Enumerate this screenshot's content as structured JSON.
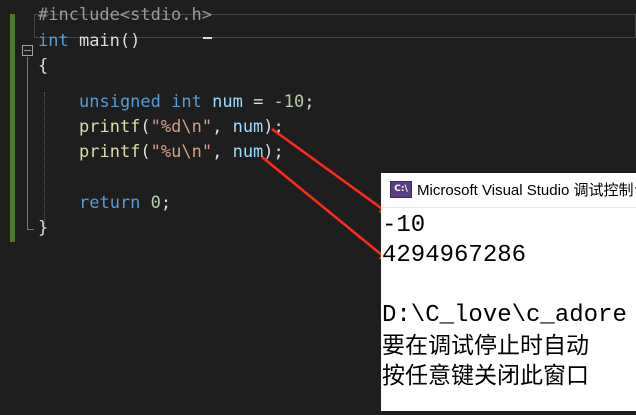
{
  "editor": {
    "lines": [
      {
        "id": "include",
        "tokens": [
          {
            "t": "#include<stdio.h>",
            "c": "pp"
          }
        ]
      },
      {
        "id": "main",
        "tokens": [
          {
            "t": "int",
            "c": "kw"
          },
          {
            "t": " main()",
            "c": "plain"
          }
        ]
      },
      {
        "id": "open-brace",
        "tokens": [
          {
            "t": "{",
            "c": "plain"
          }
        ]
      },
      {
        "id": "blank1",
        "tokens": []
      },
      {
        "id": "decl",
        "tokens": [
          {
            "t": "unsigned",
            "c": "kw"
          },
          {
            "t": " ",
            "c": "plain"
          },
          {
            "t": "int",
            "c": "kw"
          },
          {
            "t": " ",
            "c": "plain"
          },
          {
            "t": "num",
            "c": "var"
          },
          {
            "t": " = ",
            "c": "plain"
          },
          {
            "t": "-10",
            "c": "num"
          },
          {
            "t": ";",
            "c": "plain"
          }
        ]
      },
      {
        "id": "printf-d",
        "tokens": [
          {
            "t": "printf",
            "c": "fn"
          },
          {
            "t": "(",
            "c": "plain"
          },
          {
            "t": "\"%d\\n\"",
            "c": "str"
          },
          {
            "t": ", ",
            "c": "plain"
          },
          {
            "t": "num",
            "c": "var"
          },
          {
            "t": ");",
            "c": "plain"
          }
        ]
      },
      {
        "id": "printf-u",
        "tokens": [
          {
            "t": "printf",
            "c": "fn"
          },
          {
            "t": "(",
            "c": "plain"
          },
          {
            "t": "\"%u\\n\"",
            "c": "str"
          },
          {
            "t": ", ",
            "c": "plain"
          },
          {
            "t": "num",
            "c": "var"
          },
          {
            "t": ");",
            "c": "plain"
          }
        ]
      },
      {
        "id": "blank2",
        "tokens": []
      },
      {
        "id": "return",
        "tokens": [
          {
            "t": "return",
            "c": "kw"
          },
          {
            "t": " ",
            "c": "plain"
          },
          {
            "t": "0",
            "c": "num"
          },
          {
            "t": ";",
            "c": "plain"
          }
        ]
      },
      {
        "id": "close-brace",
        "tokens": [
          {
            "t": "}",
            "c": "plain"
          }
        ]
      }
    ],
    "fold_symbol": "−"
  },
  "console": {
    "icon_label": "C:\\",
    "title": "Microsoft Visual Studio 调试控制台",
    "output": [
      "-10",
      "4294967286",
      "",
      "D:\\C_love\\c_adore",
      "要在调试停止时自动",
      "按任意键关闭此窗口"
    ]
  },
  "colors": {
    "editor_bg": "#1e1e1e",
    "keyword": "#569cd6",
    "variable": "#9cdcfe",
    "string": "#d69d85",
    "number": "#b5cea8",
    "function": "#dcdcaa",
    "arrow": "#ff2a1a",
    "change_bar": "#4f7a2b"
  }
}
